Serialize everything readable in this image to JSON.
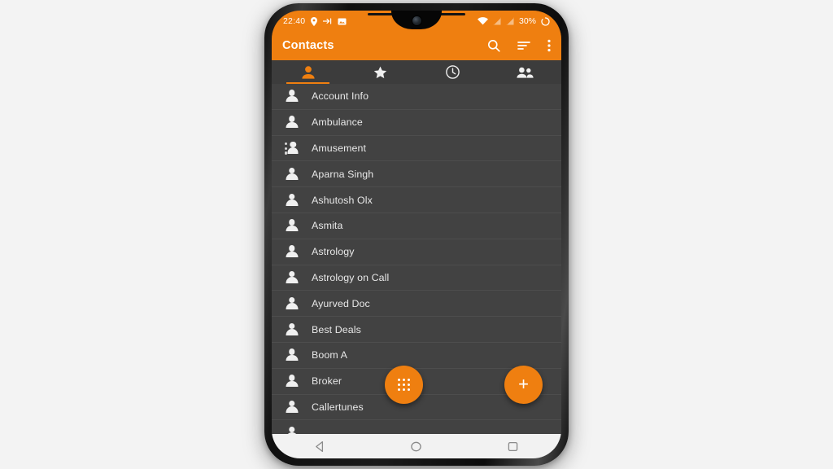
{
  "status_bar": {
    "time": "22:40",
    "battery_percent": "30%",
    "left_icons": [
      "location-pin-icon",
      "data-transfer-icon",
      "gallery-icon"
    ],
    "right_icons": [
      "wifi-icon",
      "sim1-signal-icon",
      "sim2-signal-icon",
      "battery-rotate-icon"
    ]
  },
  "app_bar": {
    "title": "Contacts",
    "actions": [
      {
        "name": "search-icon",
        "label": "Search"
      },
      {
        "name": "sort-icon",
        "label": "Sort"
      },
      {
        "name": "overflow-menu-icon",
        "label": "More options"
      }
    ]
  },
  "tabs": [
    {
      "name": "tab-contacts",
      "icon": "person-icon",
      "label": "Contacts",
      "active": true
    },
    {
      "name": "tab-favorites",
      "icon": "star-icon",
      "label": "Favorites",
      "active": false
    },
    {
      "name": "tab-history",
      "icon": "clock-icon",
      "label": "History",
      "active": false
    },
    {
      "name": "tab-groups",
      "icon": "groups-icon",
      "label": "Groups",
      "active": false
    }
  ],
  "contacts": [
    {
      "name": "Account Info",
      "icon": "person-icon"
    },
    {
      "name": "Ambulance",
      "icon": "person-icon"
    },
    {
      "name": "Amusement",
      "icon": "group-icon"
    },
    {
      "name": "Aparna Singh",
      "icon": "person-icon"
    },
    {
      "name": "Ashutosh Olx",
      "icon": "person-icon"
    },
    {
      "name": "Asmita",
      "icon": "person-icon"
    },
    {
      "name": "Astrology",
      "icon": "person-icon"
    },
    {
      "name": "Astrology on Call",
      "icon": "person-icon"
    },
    {
      "name": "Ayurved Doc",
      "icon": "person-icon"
    },
    {
      "name": "Best Deals",
      "icon": "person-icon"
    },
    {
      "name": "Boom A",
      "icon": "person-icon"
    },
    {
      "name": "Broker",
      "icon": "person-icon"
    },
    {
      "name": "Callertunes",
      "icon": "person-icon"
    },
    {
      "name": "",
      "icon": "person-icon"
    }
  ],
  "fabs": [
    {
      "name": "dialpad-fab",
      "icon": "dialpad-icon",
      "label": "Dialpad"
    },
    {
      "name": "add-contact-fab",
      "icon": "plus-icon",
      "label": "Add contact"
    }
  ],
  "nav_bar": [
    {
      "name": "nav-back-button",
      "icon": "back-triangle-icon",
      "label": "Back"
    },
    {
      "name": "nav-home-button",
      "icon": "home-circle-icon",
      "label": "Home"
    },
    {
      "name": "nav-recents-button",
      "icon": "recents-square-icon",
      "label": "Recents"
    }
  ],
  "colors": {
    "accent": "#ef7f10",
    "list_background": "#424242",
    "row_divider": "#4d4d4d",
    "text_primary": "#e8e8e8",
    "nav_bar_background": "#f2f2f2"
  }
}
